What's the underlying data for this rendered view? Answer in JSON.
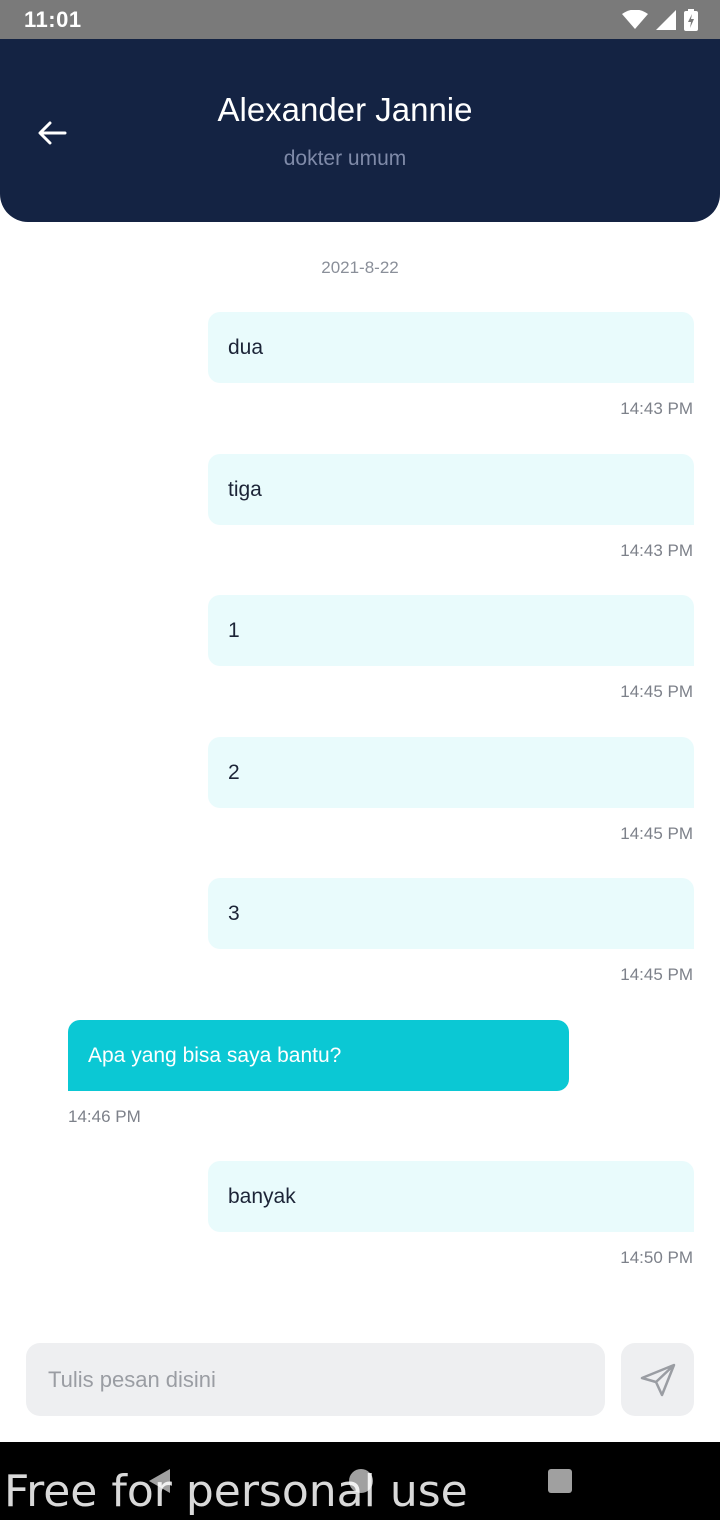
{
  "status_bar": {
    "time": "11:01"
  },
  "header": {
    "title": "Alexander Jannie",
    "subtitle": "dokter umum"
  },
  "chat": {
    "date": "2021-8-22",
    "messages": [
      {
        "text": "dua",
        "time": "14:43 PM",
        "direction": "out"
      },
      {
        "text": "tiga",
        "time": "14:43 PM",
        "direction": "out"
      },
      {
        "text": "1",
        "time": "14:45 PM",
        "direction": "out"
      },
      {
        "text": "2",
        "time": "14:45 PM",
        "direction": "out"
      },
      {
        "text": "3",
        "time": "14:45 PM",
        "direction": "out"
      },
      {
        "text": "Apa yang bisa saya bantu?",
        "time": "14:46 PM",
        "direction": "in"
      },
      {
        "text": "banyak",
        "time": "14:50 PM",
        "direction": "out"
      }
    ]
  },
  "composer": {
    "placeholder": "Tulis pesan disini",
    "value": ""
  },
  "watermark": "Free for personal use",
  "colors": {
    "header_bg": "#142343",
    "outgoing_bubble": "#e9fbfc",
    "incoming_bubble": "#0bc8d4",
    "input_bg": "#eeeff1"
  },
  "icons": [
    "arrow-left-icon",
    "send-icon",
    "wifi-icon",
    "signal-icon",
    "battery-icon",
    "nav-back-icon",
    "nav-home-icon",
    "nav-recents-icon"
  ]
}
